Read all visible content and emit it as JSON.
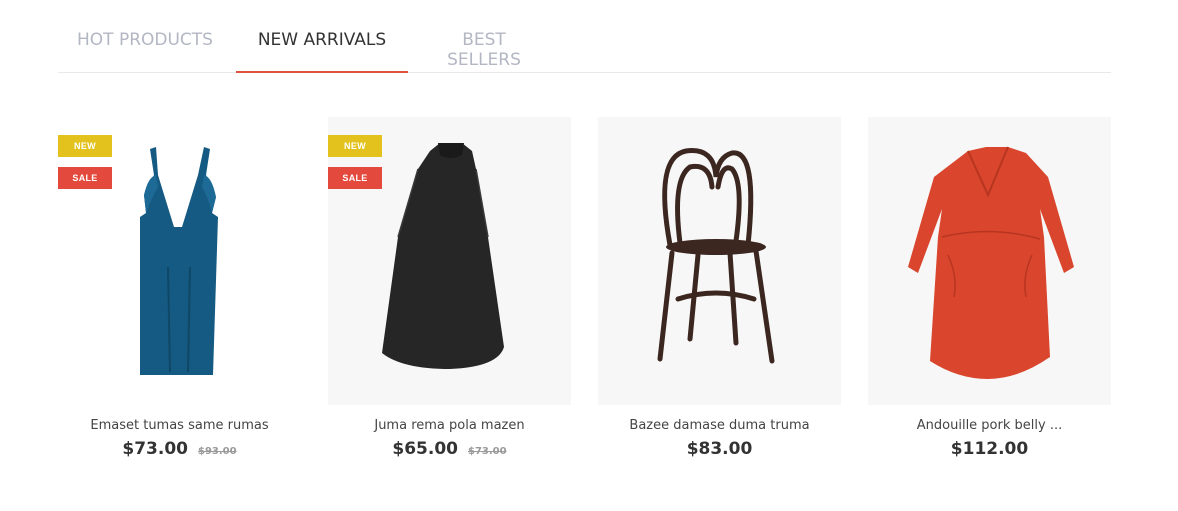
{
  "tabs": [
    {
      "label": "HOT PRODUCTS",
      "active": false
    },
    {
      "label": "NEW ARRIVALS",
      "active": true
    },
    {
      "label": "BEST SELLERS",
      "active": false
    }
  ],
  "colors": {
    "accent": "#e0533f",
    "badge_new": "#e3c21d",
    "badge_sale": "#e3493c",
    "tab_inactive": "#b3b7c3",
    "tab_active": "#333333"
  },
  "products": [
    {
      "name": "Emaset tumas same rumas",
      "price": "$73.00",
      "old_price": "$93.00",
      "badge_new": "NEW",
      "badge_sale": "SALE",
      "image": "blue-dress"
    },
    {
      "name": "Juma rema pola mazen",
      "price": "$65.00",
      "old_price": "$73.00",
      "badge_new": "NEW",
      "badge_sale": "SALE",
      "image": "black-dress"
    },
    {
      "name": "Bazee damase duma truma",
      "price": "$83.00",
      "image": "wooden-chair"
    },
    {
      "name": "Andouille pork belly ...",
      "price": "$112.00",
      "image": "red-dress"
    }
  ]
}
